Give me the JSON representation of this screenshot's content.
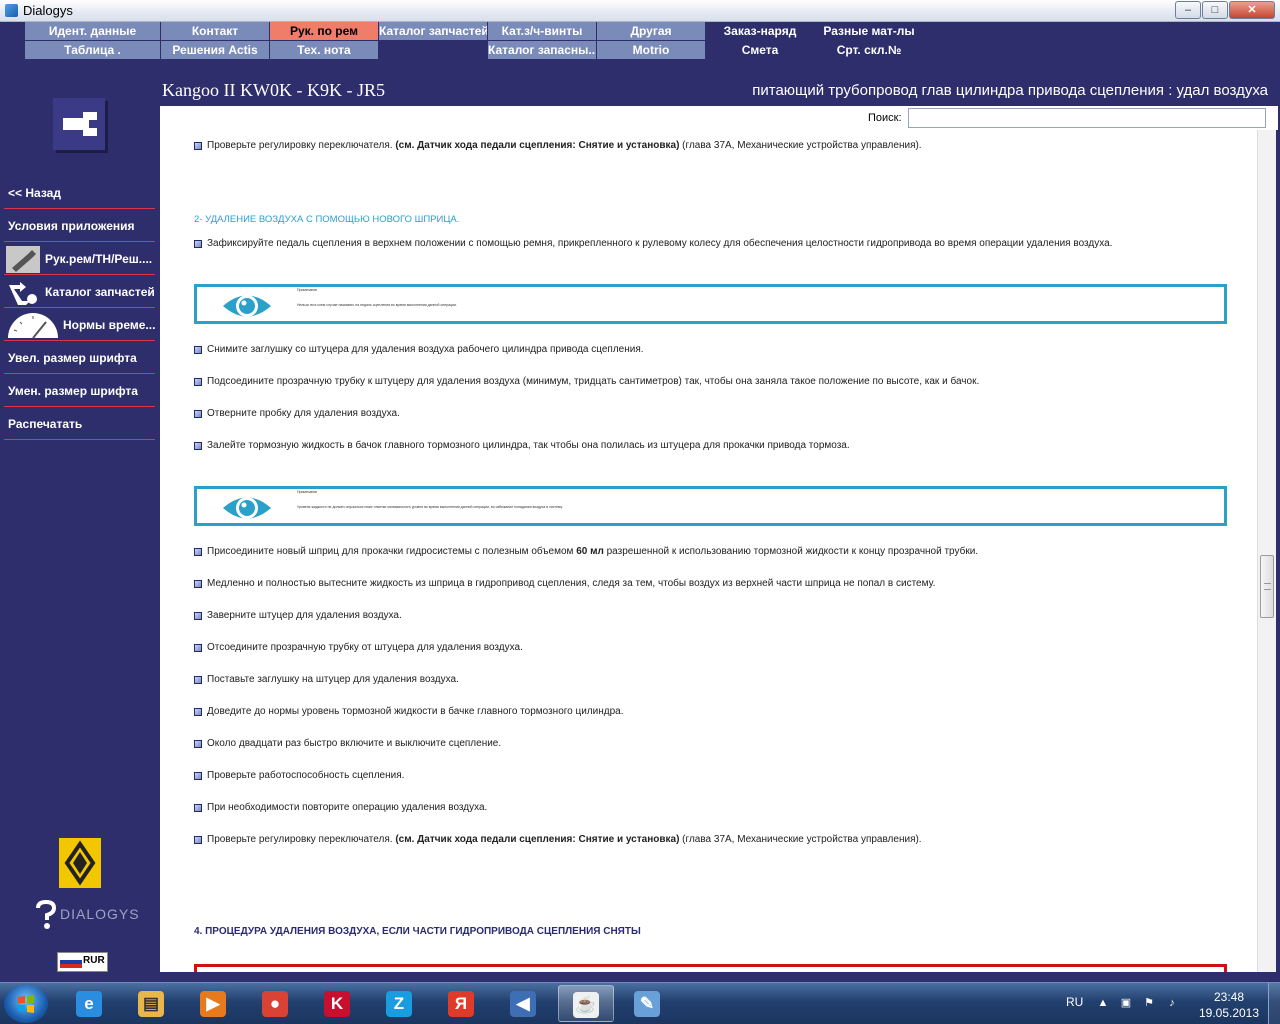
{
  "window": {
    "title": "Dialogys",
    "min": "–",
    "max": "□",
    "close": "✕"
  },
  "menu": {
    "row1": [
      "Идент. данные",
      "Контакт",
      "Рук. по рем",
      "Каталог запчастей",
      "Кат.з/ч-винты",
      "Другая",
      "Заказ-наряд",
      "Разные мат-лы"
    ],
    "row2": [
      "Таблица .",
      "Решения Actis",
      "Тех. нота",
      "",
      "Каталог запасны...",
      "Motrio",
      "Смета",
      "Срт. скл.№"
    ]
  },
  "header": {
    "vehicle": "Kangoo II KW0K - K9K - JR5",
    "section": "питающий трубопровод глав цилиндра привода сцепления : удал воздуха"
  },
  "search": {
    "label": "Поиск:",
    "value": ""
  },
  "sidebar": {
    "items": [
      {
        "label": "<< Назад",
        "icon": ""
      },
      {
        "label": "Условия приложения",
        "icon": ""
      },
      {
        "label": "Рук.рем/ТН/Реш....",
        "icon": "wrench-icon"
      },
      {
        "label": "Каталог запчастей",
        "icon": "parts-icon"
      },
      {
        "label": "Нормы време...",
        "icon": "gauge-icon"
      },
      {
        "label": "Увел. размер шрифта",
        "icon": ""
      },
      {
        "label": "Умен. размер шрифта",
        "icon": ""
      },
      {
        "label": "Распечатать",
        "icon": ""
      }
    ],
    "brand": "DIALOGYS",
    "lang": "RUR"
  },
  "content": {
    "item_top": {
      "text": "Проверьте регулировку переключателя. ",
      "bold": "(см. Датчик хода педали сцепления: Снятие и установка)",
      "tail": " (глава 37A, Механические устройства управления)."
    },
    "subheading": "2- УДАЛЕНИЕ ВОЗДУХА С ПОМОЩЬЮ НОВОГО ШПРИЦА.",
    "item_fix": "Зафиксируйте педаль сцепления в верхнем положении с помощью ремня, прикрепленного к рулевому колесу для обеспечения целостности гидропривода во время операции удаления воздуха.",
    "note1": {
      "l1": "Примечание",
      "l2": "Нельзя ни в коем случае нажимать на педаль сцепления во время выполнения данной операции."
    },
    "steps_a": [
      "Снимите заглушку со штуцера для удаления воздуха рабочего цилиндра привода сцепления.",
      "Подсоедините прозрачную трубку к штуцеру для удаления воздуха (минимум, тридцать сантиметров) так, чтобы она заняла такое положение по высоте, как и бачок.",
      "Отверните пробку для удаления воздуха.",
      "Залейте тормозную жидкость в бачок главного тормозного цилиндра, так чтобы она полилась из штуцера для прокачки привода тормоза."
    ],
    "note2": {
      "l1": "Примечание",
      "l2": "Уровень жидкости не должен опускаться ниже отметки минимального уровня во время выполнения данной операции, во избежание попадания воздуха в систему."
    },
    "item_syringe": {
      "a": "Присоедините новый шприц для прокачки гидросистемы с полезным объемом ",
      "b": "60 мл",
      "c": " разрешенной к использованию тормозной жидкости к концу прозрачной трубки."
    },
    "steps_b": [
      "Медленно и полностью вытесните жидкость из шприца в гидропривод сцепления, следя за тем, чтобы воздух из верхней части шприца не попал в систему.",
      "Заверните штуцер для удаления воздуха.",
      "Отсоедините прозрачную трубку от штуцера для удаления воздуха.",
      "Поставьте заглушку на штуцер для удаления воздуха.",
      "Доведите до нормы уровень тормозной жидкости в бачке главного тормозного цилиндра.",
      "Около двадцати раз быстро включите и выключите сцепление.",
      "Проверьте работоспособность сцепления.",
      "При необходимости повторите операцию удаления воздуха."
    ],
    "item_bottom": {
      "text": "Проверьте регулировку переключателя. ",
      "bold": "(см. Датчик хода педали сцепления: Снятие и установка)",
      "tail": " (глава 37A, Механические устройства управления)."
    },
    "heading4": "4. ПРОЦЕДУРА УДАЛЕНИЯ ВОЗДУХА, ЕСЛИ ЧАСТИ ГИДРОПРИВОДА СЦЕПЛЕНИЯ СНЯТЫ"
  },
  "taskbar": {
    "apps": [
      {
        "name": "ie",
        "glyph": "e",
        "color": "#2a8de0"
      },
      {
        "name": "explorer",
        "glyph": "▤",
        "color": "#e8b64a"
      },
      {
        "name": "media-player",
        "glyph": "▶",
        "color": "#e87a1e"
      },
      {
        "name": "chrome",
        "glyph": "●",
        "color": "#d84335"
      },
      {
        "name": "kaspersky",
        "glyph": "K",
        "color": "#c8102e"
      },
      {
        "name": "z-app",
        "glyph": "Z",
        "color": "#1a9ce0"
      },
      {
        "name": "yandex",
        "glyph": "Я",
        "color": "#e03a2a"
      },
      {
        "name": "volume",
        "glyph": "◀",
        "color": "#3e6eb4"
      },
      {
        "name": "java",
        "glyph": "☕",
        "color": "#f0f0f0"
      },
      {
        "name": "paint",
        "glyph": "✎",
        "color": "#6aa0d8"
      }
    ],
    "lang": "RU",
    "time": "23:48",
    "date": "19.05.2013"
  }
}
